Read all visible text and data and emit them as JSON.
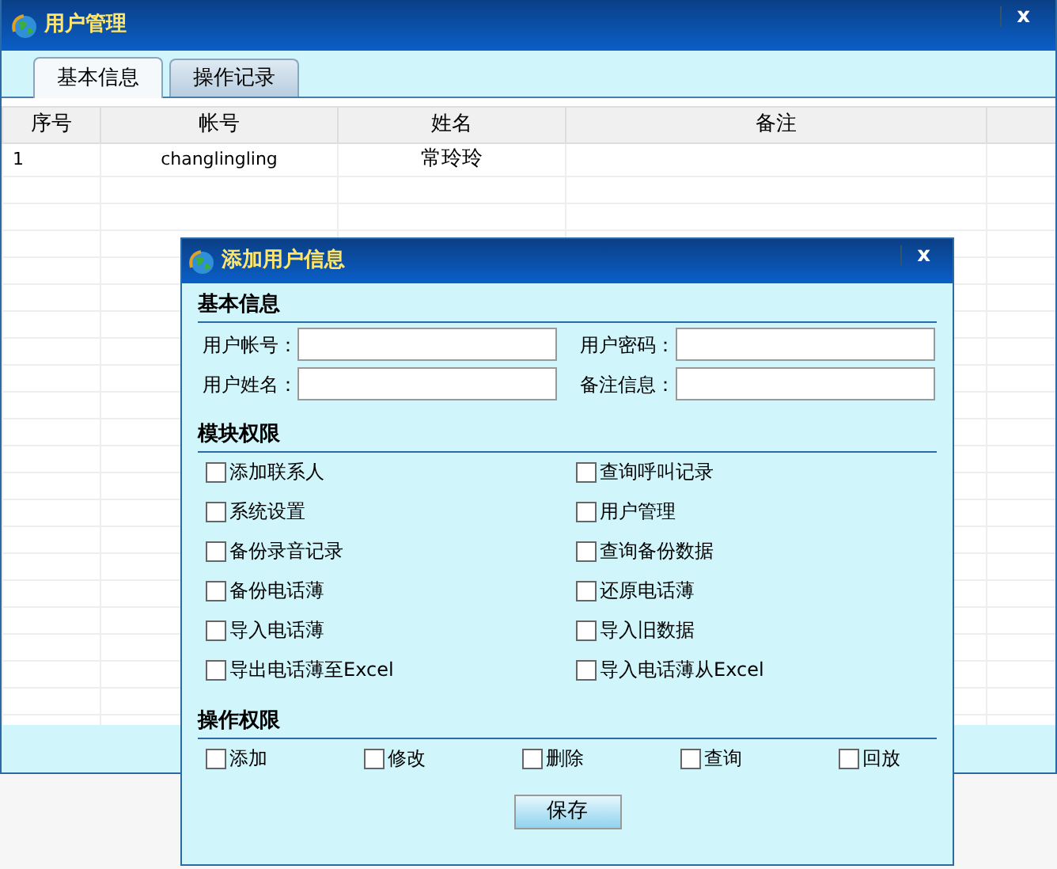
{
  "window": {
    "title": "用户管理",
    "close": "x"
  },
  "tabs": [
    {
      "label": "基本信息",
      "selected": true
    },
    {
      "label": "操作记录",
      "selected": false
    }
  ],
  "table": {
    "columns": [
      "序号",
      "帐号",
      "姓名",
      "备注"
    ],
    "rows": [
      {
        "cells": [
          "1",
          "changlingling",
          "常玲玲",
          ""
        ],
        "selected": false
      }
    ]
  },
  "dialog": {
    "title": "添加用户信息",
    "close": "x",
    "sections": [
      {
        "kind": "fields",
        "heading": "基本信息",
        "fields": [
          {
            "label": "用户帐号："
          },
          {
            "label": "用户密码："
          },
          {
            "label": "用户姓名："
          },
          {
            "label": "备注信息："
          }
        ]
      },
      {
        "kind": "checks2",
        "heading": "模块权限",
        "items": [
          {
            "label": "添加联系人",
            "checked": false
          },
          {
            "label": "查询呼叫记录",
            "checked": false
          },
          {
            "label": "系统设置",
            "checked": false
          },
          {
            "label": "用户管理",
            "checked": false
          },
          {
            "label": "备份录音记录",
            "checked": false
          },
          {
            "label": "查询备份数据",
            "checked": false
          },
          {
            "label": "备份电话薄",
            "checked": false
          },
          {
            "label": "还原电话薄",
            "checked": false
          },
          {
            "label": "导入电话薄",
            "checked": false
          },
          {
            "label": "导入旧数据",
            "checked": false
          },
          {
            "label": "导出电话薄至Excel",
            "checked": false
          },
          {
            "label": "导入电话薄从Excel",
            "checked": false
          }
        ]
      },
      {
        "kind": "checks5",
        "heading": "操作权限",
        "items": [
          {
            "label": "添加",
            "checked": false
          },
          {
            "label": "修改",
            "checked": false
          },
          {
            "label": "删除",
            "checked": false
          },
          {
            "label": "查询",
            "checked": false
          },
          {
            "label": "回放",
            "checked": false
          }
        ]
      }
    ],
    "save": "保存"
  }
}
